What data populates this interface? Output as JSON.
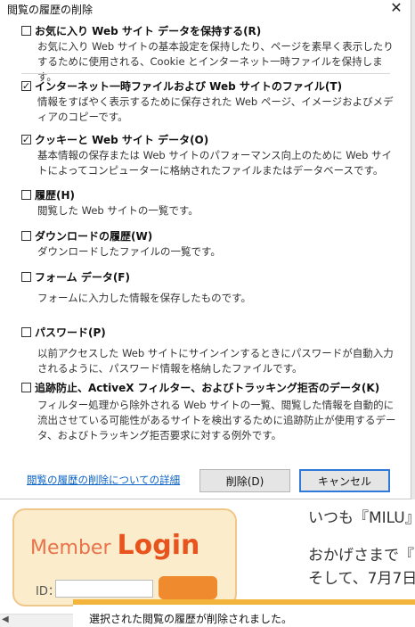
{
  "dialog": {
    "title": "閲覧の履歴の削除",
    "close_glyph": "✕",
    "options": [
      {
        "label": "お気に入り Web サイト データを保持する(R)",
        "checked": false,
        "desc": "お気に入り Web サイトの基本設定を保持したり、ページを素早く表示したりするために使用される、Cookie とインターネット一時ファイルを保持します。"
      },
      {
        "label": "インターネット一時ファイルおよび Web サイトのファイル(T)",
        "checked": true,
        "desc": "情報をすばやく表示するために保存された Web ページ、イメージおよびメディアのコピーです。"
      },
      {
        "label": "クッキーと Web サイト データ(O)",
        "checked": true,
        "desc": "基本情報の保存または Web サイトのパフォーマンス向上のために Web サイトによってコンピューターに格納されたファイルまたはデータベースです。"
      },
      {
        "label": "履歴(H)",
        "checked": false,
        "desc": "閲覧した Web サイトの一覧です。"
      },
      {
        "label": "ダウンロードの履歴(W)",
        "checked": false,
        "desc": "ダウンロードしたファイルの一覧です。"
      },
      {
        "label": "フォーム データ(F)",
        "checked": false,
        "desc": "フォームに入力した情報を保存したものです。"
      },
      {
        "label": "パスワード(P)",
        "checked": false,
        "desc": "以前アクセスした Web サイトにサインインするときにパスワードが自動入力されるように、パスワード情報を格納したファイルです。"
      },
      {
        "label": "追跡防止、ActiveX フィルター、およびトラッキング拒否のデータ(K)",
        "checked": false,
        "desc": "フィルター処理から除外される Web サイトの一覧、閲覧した情報を自動的に流出させている可能性があるサイトを検出するために追跡防止が使用するデータ、およびトラッキング拒否要求に対する例外です。"
      }
    ],
    "details_link": "閲覧の履歴の削除についての詳細",
    "delete_button": "削除(D)",
    "cancel_button": "キャンセル"
  },
  "background": {
    "login_member": "Member ",
    "login_word": "Login",
    "login_id_label": "ID：",
    "site_line1": "いつも『MILU』を",
    "site_line2": "おかげさまで『M",
    "site_line3": "そして、7月7日"
  },
  "notification": {
    "message": "選択された閲覧の履歴が削除されました。",
    "accent_color": "#f2b43a"
  },
  "colors": {
    "link": "#0b63c5",
    "cancel_border": "#2f7ad9",
    "login_orange": "#e8541e"
  }
}
